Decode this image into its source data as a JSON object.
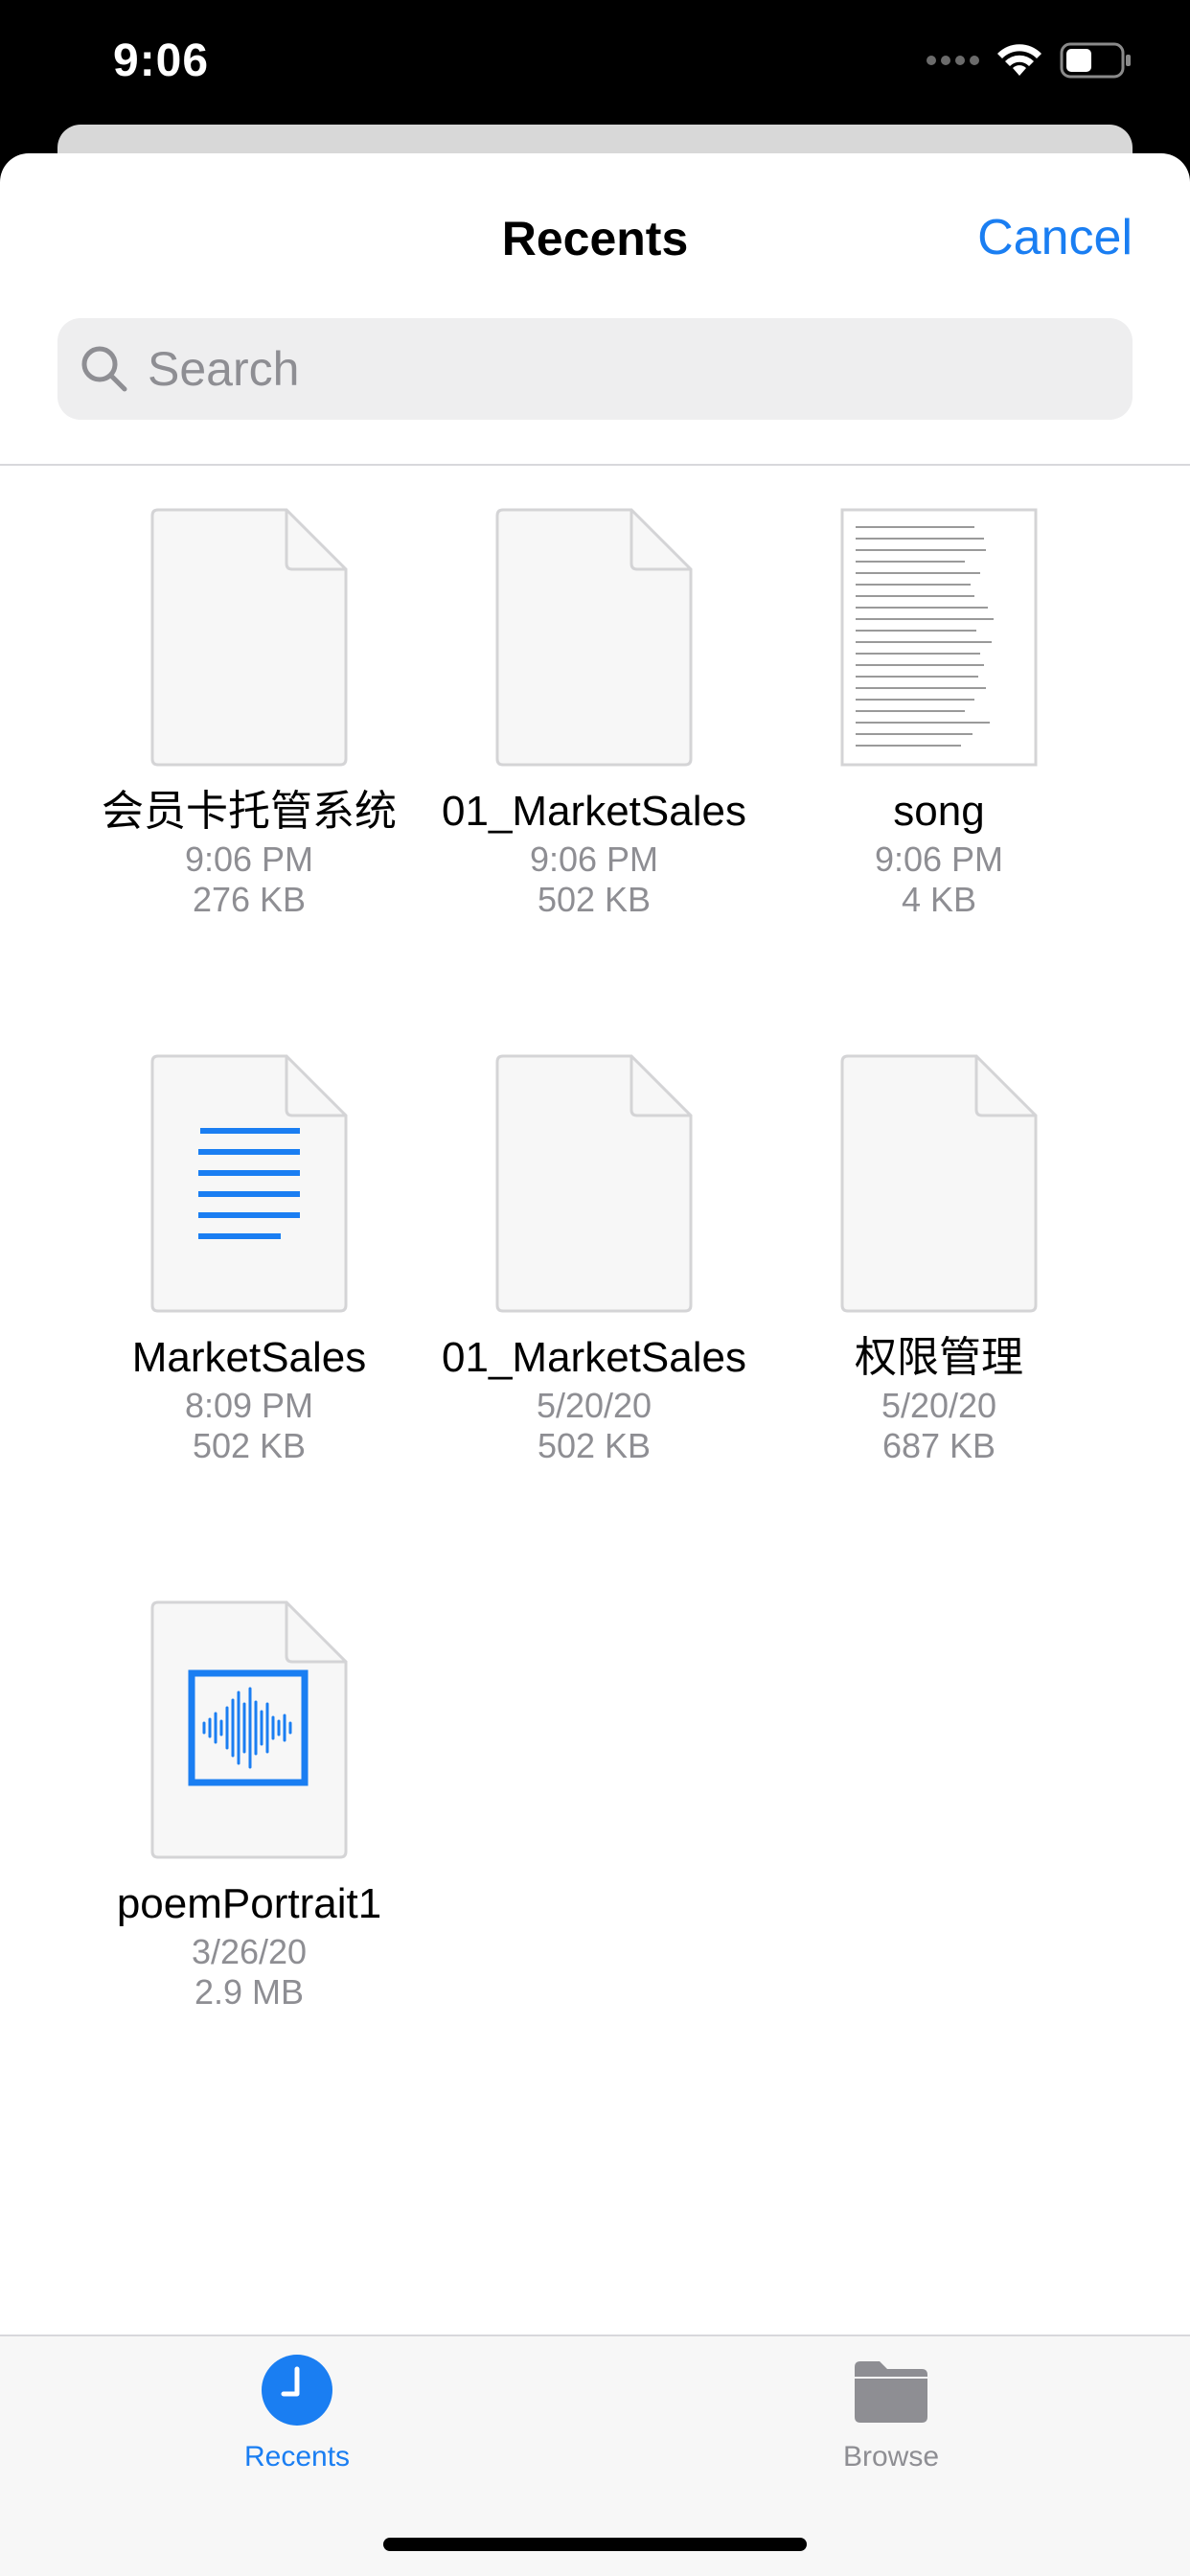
{
  "status_bar": {
    "time": "9:06"
  },
  "nav": {
    "title": "Recents",
    "cancel_label": "Cancel"
  },
  "search": {
    "placeholder": "Search",
    "value": ""
  },
  "files": [
    {
      "name": "会员卡托管系统",
      "time": "9:06 PM",
      "size": "276 KB",
      "thumbnail": "blank-document"
    },
    {
      "name": "01_MarketSales",
      "time": "9:06 PM",
      "size": "502 KB",
      "thumbnail": "blank-document"
    },
    {
      "name": "song",
      "time": "9:06 PM",
      "size": "4 KB",
      "thumbnail": "text-preview"
    },
    {
      "name": "MarketSales",
      "time": "8:09 PM",
      "size": "502 KB",
      "thumbnail": "text-lines-icon"
    },
    {
      "name": "01_MarketSales",
      "time": "5/20/20",
      "size": "502 KB",
      "thumbnail": "blank-document"
    },
    {
      "name": "权限管理",
      "time": "5/20/20",
      "size": "687 KB",
      "thumbnail": "blank-document"
    },
    {
      "name": "poemPortrait1",
      "time": "3/26/20",
      "size": "2.9 MB",
      "thumbnail": "audio-waveform-icon"
    }
  ],
  "tabs": [
    {
      "label": "Recents",
      "icon": "clock-icon",
      "active": true
    },
    {
      "label": "Browse",
      "icon": "folder-icon",
      "active": false
    }
  ],
  "colors": {
    "accent": "#1a7ef2",
    "inactive": "#8e8e93"
  }
}
